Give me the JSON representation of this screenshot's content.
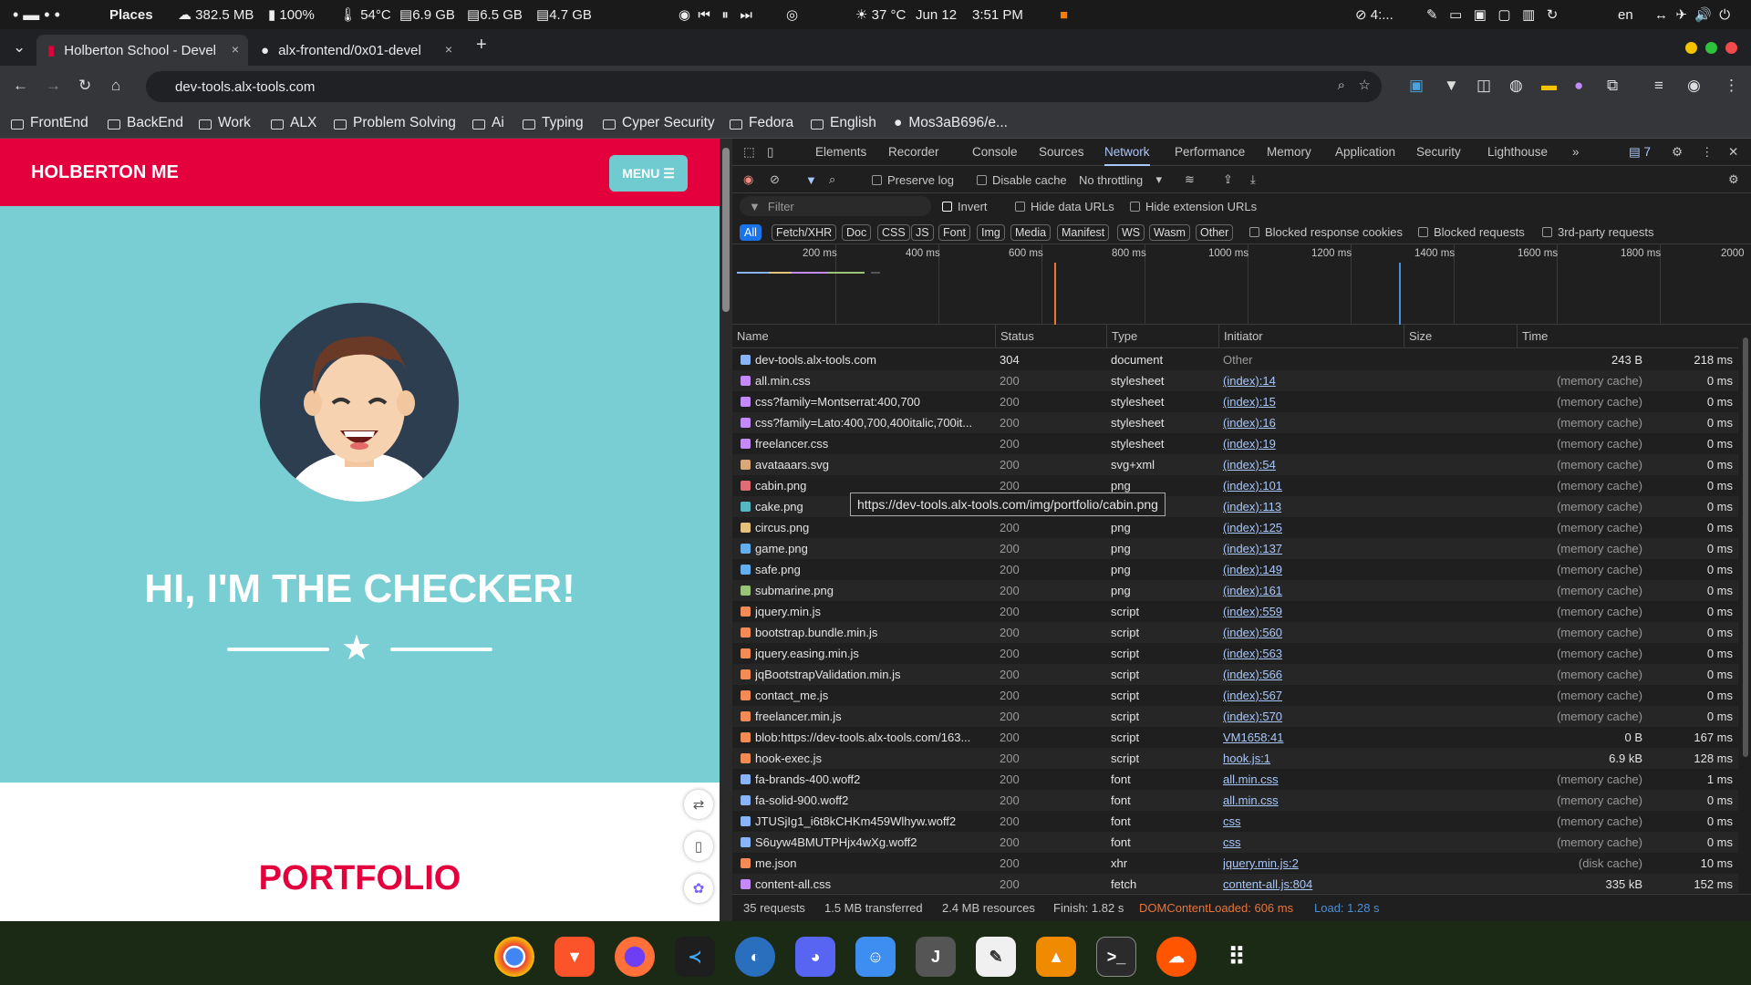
{
  "system_bar": {
    "places": "Places",
    "net": "382.5 MB",
    "battery": "100%",
    "temp_cpu": "54°C",
    "mem1": "6.9 GB",
    "mem2": "6.5 GB",
    "mem3": "4.7 GB",
    "weather": "37 °C",
    "date": "Jun 12",
    "time": "3:51 PM",
    "misc": "4:...",
    "lang": "en"
  },
  "tabs": [
    {
      "title": "Holberton School - Devel",
      "close": "×"
    },
    {
      "title": "alx-frontend/0x01-devel",
      "close": "×"
    }
  ],
  "new_tab": "+",
  "url": "dev-tools.alx-tools.com",
  "bookmarks": [
    "FrontEnd",
    "BackEnd",
    "Work",
    "ALX",
    "Problem Solving",
    "Ai",
    "Typing",
    "Cyper Security",
    "Fedora",
    "English",
    "Mos3aB696/e..."
  ],
  "site": {
    "brand": "HOLBERTON ME",
    "menu": "MENU ☰",
    "hero_title": "HI, I'M THE CHECKER!",
    "section_title": "PORTFOLIO"
  },
  "devtools": {
    "tabs": [
      "Elements",
      "Recorder",
      "Console",
      "Sources",
      "Network",
      "Performance",
      "Memory",
      "Application",
      "Security",
      "Lighthouse"
    ],
    "active_tab": "Network",
    "issues_count": "7",
    "toolbar": {
      "preserve_log": "Preserve log",
      "disable_cache": "Disable cache",
      "throttling": "No throttling"
    },
    "filter": {
      "placeholder": "Filter",
      "invert": "Invert",
      "hide_data_urls": "Hide data URLs",
      "hide_extension_urls": "Hide extension URLs"
    },
    "type_chips": [
      "All",
      "Fetch/XHR",
      "Doc",
      "CSS",
      "JS",
      "Font",
      "Img",
      "Media",
      "Manifest",
      "WS",
      "Wasm",
      "Other"
    ],
    "extra_filters": [
      "Blocked response cookies",
      "Blocked requests",
      "3rd-party requests"
    ],
    "timeline_ticks": [
      "200 ms",
      "400 ms",
      "600 ms",
      "800 ms",
      "1000 ms",
      "1200 ms",
      "1400 ms",
      "1600 ms",
      "1800 ms",
      "2000"
    ],
    "columns": [
      "Name",
      "Status",
      "Type",
      "Initiator",
      "Size",
      "Time"
    ],
    "rows": [
      {
        "name": "dev-tools.alx-tools.com",
        "status": "304",
        "type": "document",
        "initiator": "Other",
        "size": "243 B",
        "time": "218 ms",
        "icon": "#8ab4f8"
      },
      {
        "name": "all.min.css",
        "status": "200",
        "type": "stylesheet",
        "initiator": "(index):14",
        "size": "(memory cache)",
        "time": "0 ms",
        "icon": "#c58af9"
      },
      {
        "name": "css?family=Montserrat:400,700",
        "status": "200",
        "type": "stylesheet",
        "initiator": "(index):15",
        "size": "(memory cache)",
        "time": "0 ms",
        "icon": "#c58af9"
      },
      {
        "name": "css?family=Lato:400,700,400italic,700it...",
        "status": "200",
        "type": "stylesheet",
        "initiator": "(index):16",
        "size": "(memory cache)",
        "time": "0 ms",
        "icon": "#c58af9"
      },
      {
        "name": "freelancer.css",
        "status": "200",
        "type": "stylesheet",
        "initiator": "(index):19",
        "size": "(memory cache)",
        "time": "0 ms",
        "icon": "#c58af9"
      },
      {
        "name": "avataaars.svg",
        "status": "200",
        "type": "svg+xml",
        "initiator": "(index):54",
        "size": "(memory cache)",
        "time": "0 ms",
        "icon": "#d8a878"
      },
      {
        "name": "cabin.png",
        "status": "200",
        "type": "png",
        "initiator": "(index):101",
        "size": "(memory cache)",
        "time": "0 ms",
        "icon": "#e06c75"
      },
      {
        "name": "cake.png",
        "status": "200",
        "type": "png",
        "initiator": "(index):113",
        "size": "(memory cache)",
        "time": "0 ms",
        "icon": "#56b6c2"
      },
      {
        "name": "circus.png",
        "status": "200",
        "type": "png",
        "initiator": "(index):125",
        "size": "(memory cache)",
        "time": "0 ms",
        "icon": "#e5c07b"
      },
      {
        "name": "game.png",
        "status": "200",
        "type": "png",
        "initiator": "(index):137",
        "size": "(memory cache)",
        "time": "0 ms",
        "icon": "#61afef"
      },
      {
        "name": "safe.png",
        "status": "200",
        "type": "png",
        "initiator": "(index):149",
        "size": "(memory cache)",
        "time": "0 ms",
        "icon": "#61afef"
      },
      {
        "name": "submarine.png",
        "status": "200",
        "type": "png",
        "initiator": "(index):161",
        "size": "(memory cache)",
        "time": "0 ms",
        "icon": "#98c379"
      },
      {
        "name": "jquery.min.js",
        "status": "200",
        "type": "script",
        "initiator": "(index):559",
        "size": "(memory cache)",
        "time": "0 ms",
        "icon": "#f28b54"
      },
      {
        "name": "bootstrap.bundle.min.js",
        "status": "200",
        "type": "script",
        "initiator": "(index):560",
        "size": "(memory cache)",
        "time": "0 ms",
        "icon": "#f28b54"
      },
      {
        "name": "jquery.easing.min.js",
        "status": "200",
        "type": "script",
        "initiator": "(index):563",
        "size": "(memory cache)",
        "time": "0 ms",
        "icon": "#f28b54"
      },
      {
        "name": "jqBootstrapValidation.min.js",
        "status": "200",
        "type": "script",
        "initiator": "(index):566",
        "size": "(memory cache)",
        "time": "0 ms",
        "icon": "#f28b54"
      },
      {
        "name": "contact_me.js",
        "status": "200",
        "type": "script",
        "initiator": "(index):567",
        "size": "(memory cache)",
        "time": "0 ms",
        "icon": "#f28b54"
      },
      {
        "name": "freelancer.min.js",
        "status": "200",
        "type": "script",
        "initiator": "(index):570",
        "size": "(memory cache)",
        "time": "0 ms",
        "icon": "#f28b54"
      },
      {
        "name": "blob:https://dev-tools.alx-tools.com/163...",
        "status": "200",
        "type": "script",
        "initiator": "VM1658:41",
        "size": "0 B",
        "time": "167 ms",
        "icon": "#f28b54"
      },
      {
        "name": "hook-exec.js",
        "status": "200",
        "type": "script",
        "initiator": "hook.js:1",
        "size": "6.9 kB",
        "time": "128 ms",
        "icon": "#f28b54"
      },
      {
        "name": "fa-brands-400.woff2",
        "status": "200",
        "type": "font",
        "initiator": "all.min.css",
        "size": "(memory cache)",
        "time": "1 ms",
        "icon": "#8ab4f8"
      },
      {
        "name": "fa-solid-900.woff2",
        "status": "200",
        "type": "font",
        "initiator": "all.min.css",
        "size": "(memory cache)",
        "time": "0 ms",
        "icon": "#8ab4f8"
      },
      {
        "name": "JTUSjIg1_i6t8kCHKm459Wlhyw.woff2",
        "status": "200",
        "type": "font",
        "initiator": "css",
        "size": "(memory cache)",
        "time": "0 ms",
        "icon": "#8ab4f8"
      },
      {
        "name": "S6uyw4BMUTPHjx4wXg.woff2",
        "status": "200",
        "type": "font",
        "initiator": "css",
        "size": "(memory cache)",
        "time": "0 ms",
        "icon": "#8ab4f8"
      },
      {
        "name": "me.json",
        "status": "200",
        "type": "xhr",
        "initiator": "jquery.min.js:2",
        "size": "(disk cache)",
        "time": "10 ms",
        "icon": "#f28b54"
      },
      {
        "name": "content-all.css",
        "status": "200",
        "type": "fetch",
        "initiator": "content-all.js:804",
        "size": "335 kB",
        "time": "152 ms",
        "icon": "#c58af9"
      }
    ],
    "tooltip": "https://dev-tools.alx-tools.com/img/portfolio/cabin.png",
    "status": {
      "requests": "35 requests",
      "transferred": "1.5 MB transferred",
      "resources": "2.4 MB resources",
      "finish": "Finish: 1.82 s",
      "dcl": "DOMContentLoaded: 606 ms",
      "load": "Load: 1.28 s"
    }
  },
  "colors": {
    "brand_red": "#e3003d",
    "hero_teal": "#78ced3",
    "devtools_bg": "#1f1f1f",
    "link_blue": "#a8c7fa"
  },
  "dock_apps": [
    "chrome-icon",
    "brave-icon",
    "firefox-icon",
    "vscode-icon",
    "github-desktop-icon",
    "discord-icon",
    "finder-icon",
    "jetbrains-icon",
    "text-editor-icon",
    "vlc-icon",
    "terminal-icon",
    "soundcloud-icon",
    "app-grid-icon"
  ]
}
